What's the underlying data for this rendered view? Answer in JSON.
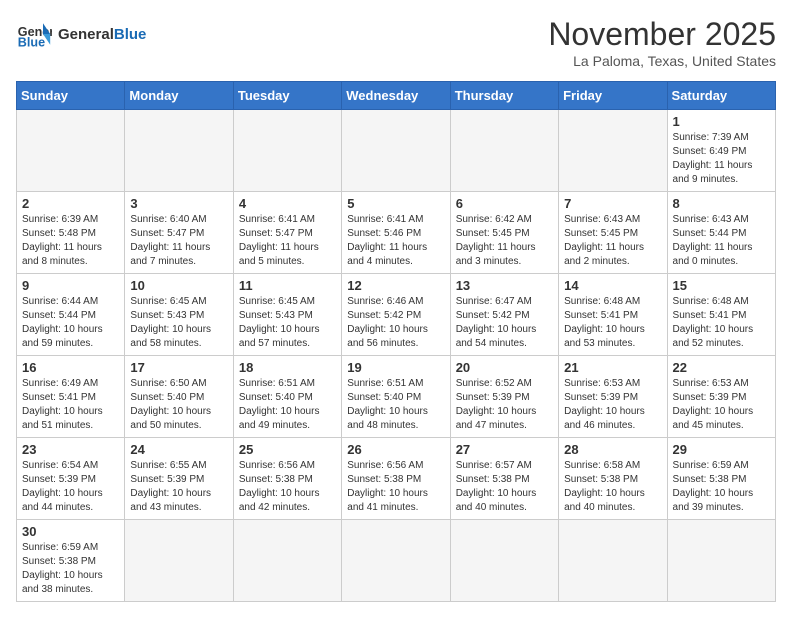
{
  "header": {
    "logo_general": "General",
    "logo_blue": "Blue",
    "month_title": "November 2025",
    "location": "La Paloma, Texas, United States"
  },
  "days_of_week": [
    "Sunday",
    "Monday",
    "Tuesday",
    "Wednesday",
    "Thursday",
    "Friday",
    "Saturday"
  ],
  "weeks": [
    [
      {
        "day": "",
        "info": ""
      },
      {
        "day": "",
        "info": ""
      },
      {
        "day": "",
        "info": ""
      },
      {
        "day": "",
        "info": ""
      },
      {
        "day": "",
        "info": ""
      },
      {
        "day": "",
        "info": ""
      },
      {
        "day": "1",
        "info": "Sunrise: 7:39 AM\nSunset: 6:49 PM\nDaylight: 11 hours and 9 minutes."
      }
    ],
    [
      {
        "day": "2",
        "info": "Sunrise: 6:39 AM\nSunset: 5:48 PM\nDaylight: 11 hours and 8 minutes."
      },
      {
        "day": "3",
        "info": "Sunrise: 6:40 AM\nSunset: 5:47 PM\nDaylight: 11 hours and 7 minutes."
      },
      {
        "day": "4",
        "info": "Sunrise: 6:41 AM\nSunset: 5:47 PM\nDaylight: 11 hours and 5 minutes."
      },
      {
        "day": "5",
        "info": "Sunrise: 6:41 AM\nSunset: 5:46 PM\nDaylight: 11 hours and 4 minutes."
      },
      {
        "day": "6",
        "info": "Sunrise: 6:42 AM\nSunset: 5:45 PM\nDaylight: 11 hours and 3 minutes."
      },
      {
        "day": "7",
        "info": "Sunrise: 6:43 AM\nSunset: 5:45 PM\nDaylight: 11 hours and 2 minutes."
      },
      {
        "day": "8",
        "info": "Sunrise: 6:43 AM\nSunset: 5:44 PM\nDaylight: 11 hours and 0 minutes."
      }
    ],
    [
      {
        "day": "9",
        "info": "Sunrise: 6:44 AM\nSunset: 5:44 PM\nDaylight: 10 hours and 59 minutes."
      },
      {
        "day": "10",
        "info": "Sunrise: 6:45 AM\nSunset: 5:43 PM\nDaylight: 10 hours and 58 minutes."
      },
      {
        "day": "11",
        "info": "Sunrise: 6:45 AM\nSunset: 5:43 PM\nDaylight: 10 hours and 57 minutes."
      },
      {
        "day": "12",
        "info": "Sunrise: 6:46 AM\nSunset: 5:42 PM\nDaylight: 10 hours and 56 minutes."
      },
      {
        "day": "13",
        "info": "Sunrise: 6:47 AM\nSunset: 5:42 PM\nDaylight: 10 hours and 54 minutes."
      },
      {
        "day": "14",
        "info": "Sunrise: 6:48 AM\nSunset: 5:41 PM\nDaylight: 10 hours and 53 minutes."
      },
      {
        "day": "15",
        "info": "Sunrise: 6:48 AM\nSunset: 5:41 PM\nDaylight: 10 hours and 52 minutes."
      }
    ],
    [
      {
        "day": "16",
        "info": "Sunrise: 6:49 AM\nSunset: 5:41 PM\nDaylight: 10 hours and 51 minutes."
      },
      {
        "day": "17",
        "info": "Sunrise: 6:50 AM\nSunset: 5:40 PM\nDaylight: 10 hours and 50 minutes."
      },
      {
        "day": "18",
        "info": "Sunrise: 6:51 AM\nSunset: 5:40 PM\nDaylight: 10 hours and 49 minutes."
      },
      {
        "day": "19",
        "info": "Sunrise: 6:51 AM\nSunset: 5:40 PM\nDaylight: 10 hours and 48 minutes."
      },
      {
        "day": "20",
        "info": "Sunrise: 6:52 AM\nSunset: 5:39 PM\nDaylight: 10 hours and 47 minutes."
      },
      {
        "day": "21",
        "info": "Sunrise: 6:53 AM\nSunset: 5:39 PM\nDaylight: 10 hours and 46 minutes."
      },
      {
        "day": "22",
        "info": "Sunrise: 6:53 AM\nSunset: 5:39 PM\nDaylight: 10 hours and 45 minutes."
      }
    ],
    [
      {
        "day": "23",
        "info": "Sunrise: 6:54 AM\nSunset: 5:39 PM\nDaylight: 10 hours and 44 minutes."
      },
      {
        "day": "24",
        "info": "Sunrise: 6:55 AM\nSunset: 5:39 PM\nDaylight: 10 hours and 43 minutes."
      },
      {
        "day": "25",
        "info": "Sunrise: 6:56 AM\nSunset: 5:38 PM\nDaylight: 10 hours and 42 minutes."
      },
      {
        "day": "26",
        "info": "Sunrise: 6:56 AM\nSunset: 5:38 PM\nDaylight: 10 hours and 41 minutes."
      },
      {
        "day": "27",
        "info": "Sunrise: 6:57 AM\nSunset: 5:38 PM\nDaylight: 10 hours and 40 minutes."
      },
      {
        "day": "28",
        "info": "Sunrise: 6:58 AM\nSunset: 5:38 PM\nDaylight: 10 hours and 40 minutes."
      },
      {
        "day": "29",
        "info": "Sunrise: 6:59 AM\nSunset: 5:38 PM\nDaylight: 10 hours and 39 minutes."
      }
    ],
    [
      {
        "day": "30",
        "info": "Sunrise: 6:59 AM\nSunset: 5:38 PM\nDaylight: 10 hours and 38 minutes."
      },
      {
        "day": "",
        "info": ""
      },
      {
        "day": "",
        "info": ""
      },
      {
        "day": "",
        "info": ""
      },
      {
        "day": "",
        "info": ""
      },
      {
        "day": "",
        "info": ""
      },
      {
        "day": "",
        "info": ""
      }
    ]
  ]
}
